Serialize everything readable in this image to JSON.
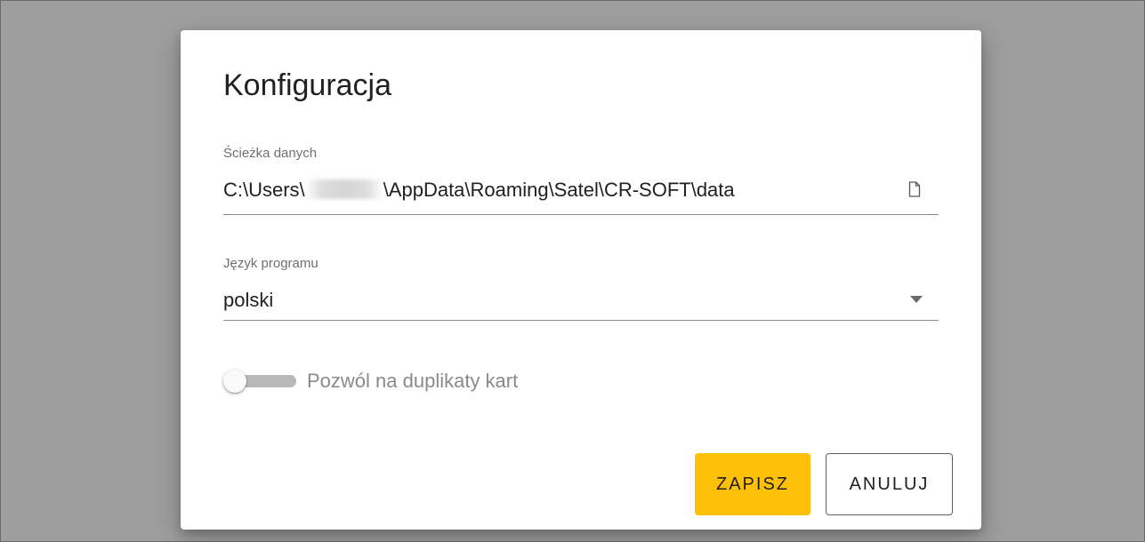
{
  "dialog": {
    "title": "Konfiguracja",
    "data_path": {
      "label": "Ścieżka danych",
      "value_prefix": "C:\\Users\\",
      "value_suffix": "\\AppData\\Roaming\\Satel\\CR-SOFT\\data",
      "icon": "file-icon"
    },
    "language": {
      "label": "Język programu",
      "value": "polski",
      "icon": "dropdown-arrow-icon"
    },
    "duplicates_toggle": {
      "label": "Pozwól na duplikaty kart",
      "enabled": false
    },
    "buttons": {
      "save_label": "ZAPISZ",
      "cancel_label": "ANULUJ"
    }
  },
  "colors": {
    "backdrop": "#9e9e9e",
    "dialog_background": "#ffffff",
    "save_button": "#ffc107",
    "toggle_track": "#b9b9b9",
    "label_text": "#6f6f6f"
  }
}
